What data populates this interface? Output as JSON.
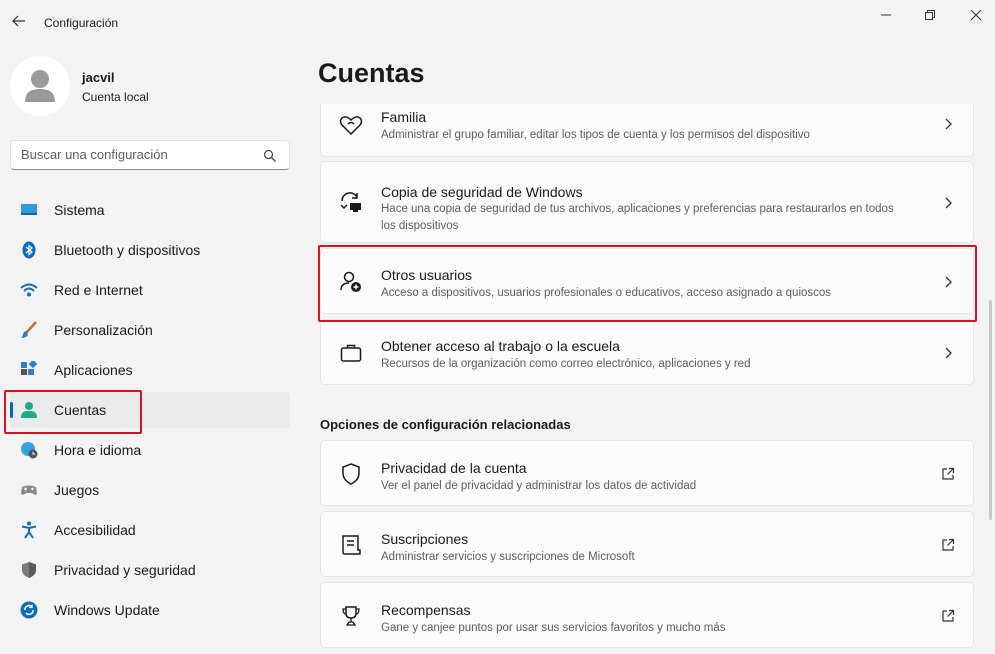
{
  "window": {
    "title": "Configuración"
  },
  "profile": {
    "name": "jacvil",
    "account_type": "Cuenta local"
  },
  "search": {
    "placeholder": "Buscar una configuración"
  },
  "nav": {
    "items": [
      {
        "label": "Sistema",
        "icon": "monitor-icon"
      },
      {
        "label": "Bluetooth y dispositivos",
        "icon": "bluetooth-icon"
      },
      {
        "label": "Red e Internet",
        "icon": "wifi-icon"
      },
      {
        "label": "Personalización",
        "icon": "brush-icon"
      },
      {
        "label": "Aplicaciones",
        "icon": "apps-icon"
      },
      {
        "label": "Cuentas",
        "icon": "person-icon",
        "active": true
      },
      {
        "label": "Hora e idioma",
        "icon": "globe-clock-icon"
      },
      {
        "label": "Juegos",
        "icon": "gamepad-icon"
      },
      {
        "label": "Accesibilidad",
        "icon": "accessibility-icon"
      },
      {
        "label": "Privacidad y seguridad",
        "icon": "shield-icon"
      },
      {
        "label": "Windows Update",
        "icon": "update-icon"
      }
    ]
  },
  "main": {
    "title": "Cuentas",
    "cards": [
      {
        "title": "Familia",
        "description": "Administrar el grupo familiar, editar los tipos de cuenta y los permisos del dispositivo",
        "icon": "family-heart-icon"
      },
      {
        "title": "Copia de seguridad de Windows",
        "description": "Hace una copia de seguridad de tus archivos, aplicaciones y preferencias para restaurarlos en todos los dispositivos",
        "icon": "backup-icon"
      },
      {
        "title": "Otros usuarios",
        "description": "Acceso a dispositivos, usuarios profesionales o educativos, acceso asignado a quioscos",
        "icon": "add-user-icon"
      },
      {
        "title": "Obtener acceso al trabajo o la escuela",
        "description": "Recursos de la organización como correo electrónico, aplicaciones y red",
        "icon": "briefcase-icon"
      }
    ],
    "related_section_title": "Opciones de configuración relacionadas",
    "related": [
      {
        "title": "Privacidad de la cuenta",
        "description": "Ver el panel de privacidad y administrar los datos de actividad",
        "icon": "shield-outline-icon"
      },
      {
        "title": "Suscripciones",
        "description": "Administrar servicios y suscripciones de Microsoft",
        "icon": "subscription-icon"
      },
      {
        "title": "Recompensas",
        "description": "Gane y canjee puntos por usar sus servicios favoritos y mucho más",
        "icon": "trophy-icon"
      }
    ]
  },
  "colors": {
    "accent": "#0067c0",
    "highlight": "#d9141e",
    "background": "#f3f3f3",
    "card": "#fbfbfb"
  }
}
